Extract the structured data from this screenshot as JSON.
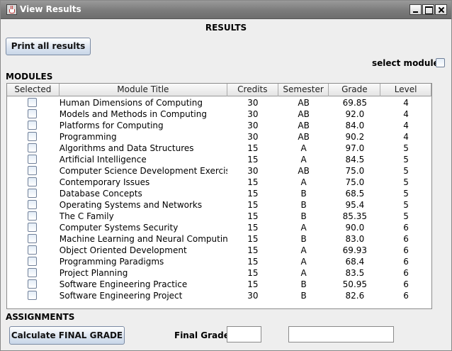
{
  "window": {
    "title": "View Results"
  },
  "header": {
    "heading": "RESULTS",
    "print_label": "Print all results",
    "select_modules_label": "select modules"
  },
  "modules": {
    "section_label": "MODULES",
    "columns": [
      "Selected",
      "Module Title",
      "Credits",
      "Semester",
      "Grade",
      "Level"
    ],
    "rows": [
      {
        "title": "Human Dimensions of Computing",
        "credits": "30",
        "semester": "AB",
        "grade": "69.85",
        "level": "4"
      },
      {
        "title": "Models and Methods in Computing",
        "credits": "30",
        "semester": "AB",
        "grade": "92.0",
        "level": "4"
      },
      {
        "title": "Platforms for Computing",
        "credits": "30",
        "semester": "AB",
        "grade": "84.0",
        "level": "4"
      },
      {
        "title": "Programming",
        "credits": "30",
        "semester": "AB",
        "grade": "90.2",
        "level": "4"
      },
      {
        "title": "Algorithms and Data Structures",
        "credits": "15",
        "semester": "A",
        "grade": "97.0",
        "level": "5"
      },
      {
        "title": "Artificial Intelligence",
        "credits": "15",
        "semester": "A",
        "grade": "84.5",
        "level": "5"
      },
      {
        "title": "Computer Science Development Exercise",
        "credits": "30",
        "semester": "AB",
        "grade": "75.0",
        "level": "5"
      },
      {
        "title": "Contemporary Issues",
        "credits": "15",
        "semester": "A",
        "grade": "75.0",
        "level": "5"
      },
      {
        "title": "Database Concepts",
        "credits": "15",
        "semester": "B",
        "grade": "68.5",
        "level": "5"
      },
      {
        "title": "Operating Systems and Networks",
        "credits": "15",
        "semester": "B",
        "grade": "95.4",
        "level": "5"
      },
      {
        "title": "The C Family",
        "credits": "15",
        "semester": "B",
        "grade": "85.35",
        "level": "5"
      },
      {
        "title": "Computer Systems Security",
        "credits": "15",
        "semester": "A",
        "grade": "90.0",
        "level": "6"
      },
      {
        "title": "Machine Learning and Neural Computing",
        "credits": "15",
        "semester": "B",
        "grade": "83.0",
        "level": "6"
      },
      {
        "title": "Object Oriented Development",
        "credits": "15",
        "semester": "A",
        "grade": "69.93",
        "level": "6"
      },
      {
        "title": "Programming Paradigms",
        "credits": "15",
        "semester": "A",
        "grade": "68.4",
        "level": "6"
      },
      {
        "title": "Project Planning",
        "credits": "15",
        "semester": "A",
        "grade": "83.5",
        "level": "6"
      },
      {
        "title": "Software Engineering Practice",
        "credits": "15",
        "semester": "B",
        "grade": "50.95",
        "level": "6"
      },
      {
        "title": "Software Engineering Project",
        "credits": "30",
        "semester": "B",
        "grade": "82.6",
        "level": "6"
      }
    ]
  },
  "assignments": {
    "section_label": "ASSIGNMENTS",
    "calculate_label": "Calculate FINAL GRADE",
    "final_grade_label": "Final Grade:",
    "final_grade_value": "",
    "result_value": ""
  }
}
